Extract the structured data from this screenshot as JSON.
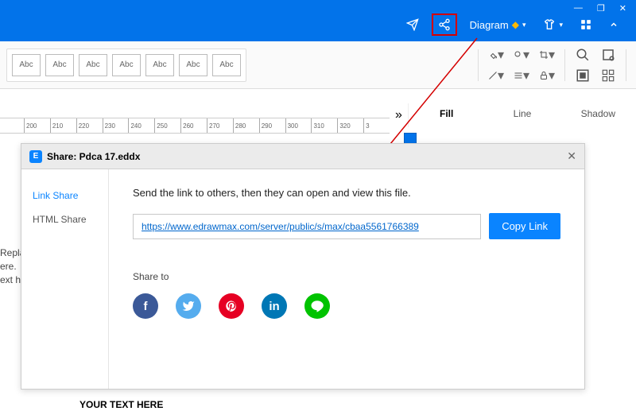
{
  "titlebar": {
    "diagram_label": "Diagram"
  },
  "ribbon": {
    "shape_label": "Abc"
  },
  "right_tabs": {
    "expand": "»",
    "fill": "Fill",
    "line": "Line",
    "shadow": "Shadow"
  },
  "ruler": {
    "ticks": [
      "200",
      "210",
      "220",
      "230",
      "240",
      "250",
      "260",
      "270",
      "280",
      "290",
      "300",
      "310",
      "320",
      "3"
    ]
  },
  "canvas": {
    "placeholder1_l1": "Repla",
    "placeholder1_l2": "ere.",
    "placeholder1_l3": "ext h",
    "placeholder2": "YOUR TEXT HERE"
  },
  "modal": {
    "title": "Share: Pdca 17.eddx",
    "logo_letter": "E",
    "sidebar": {
      "link_share": "Link Share",
      "html_share": "HTML Share"
    },
    "desc": "Send the link to others, then they can open and view this file.",
    "url": "https://www.edrawmax.com/server/public/s/max/cbaa5561766389",
    "copy_btn": "Copy Link",
    "share_to_label": "Share to",
    "icons": {
      "fb": "f",
      "tw": "t",
      "pin": "P",
      "li": "in",
      "line": "L"
    }
  }
}
